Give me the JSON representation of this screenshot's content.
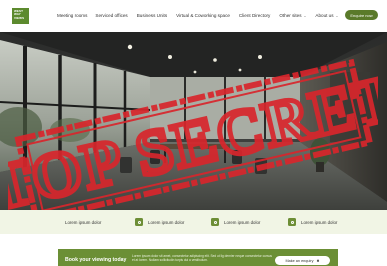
{
  "logo": {
    "lines": [
      "WEST",
      "WAY",
      "VIEWS"
    ]
  },
  "nav": {
    "links": [
      {
        "label": "Meeting rooms",
        "caret": ""
      },
      {
        "label": "Serviced offices",
        "caret": ""
      },
      {
        "label": "Business Units",
        "caret": ""
      },
      {
        "label": "Virtual & Coworking space",
        "caret": ""
      },
      {
        "label": "Client Directory",
        "caret": ""
      },
      {
        "label": "Other sites",
        "caret": "⌄"
      },
      {
        "label": "About us",
        "caret": "⌄"
      }
    ],
    "enquire_label": "Enquire now"
  },
  "stamp": {
    "text": "TOP SECRET",
    "color": "#d8262c"
  },
  "features": [
    {
      "label": "Lorem ipsum dolor",
      "icon": "feature-icon"
    },
    {
      "label": "Lorem ipsum dolor",
      "icon": "feature-icon"
    },
    {
      "label": "Lorem ipsum dolor",
      "icon": "feature-icon"
    },
    {
      "label": "Lorem ipsum dolor",
      "icon": "feature-icon"
    }
  ],
  "cta": {
    "title": "Book your viewing today",
    "body": "Lorem ipsum dolor sit amet, consectetur adipiscing elit. Sed ut lig dernier neque consectetur cursus et at lorem. Nullam sollicitudin turpis dui a vestibulum.",
    "button_label": "Make an enquiry",
    "button_icon": "✖"
  },
  "colors": {
    "brand": "#5a7a2a",
    "strip": "#f1f5e5",
    "stamp": "#d8262c"
  }
}
